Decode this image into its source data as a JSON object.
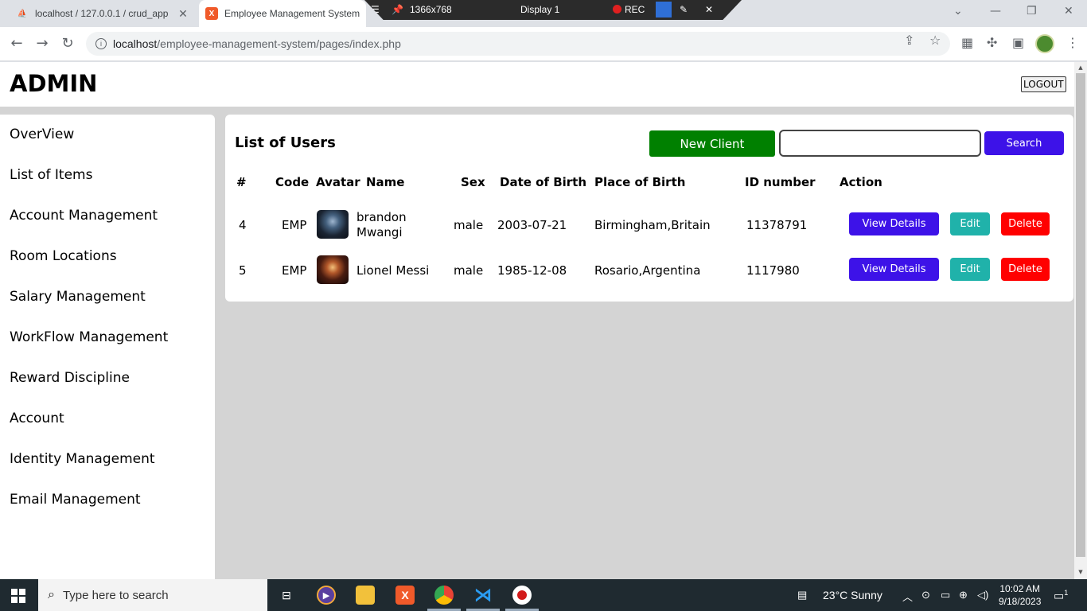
{
  "browser": {
    "tabs": [
      {
        "label": "localhost / 127.0.0.1 / crud_app /",
        "favicon": "phpmyadmin-icon"
      },
      {
        "label": "Employee Management System",
        "favicon": "xampp-icon"
      }
    ],
    "recorder": {
      "resolution": "1366x768",
      "display": "Display 1",
      "rec_label": "REC"
    },
    "url_host": "localhost",
    "url_path": "/employee-management-system/pages/index.php"
  },
  "app": {
    "brand": "ADMIN",
    "logout_label": "LOGOUT",
    "sidebar": [
      "OverView",
      "List of Items",
      "Account Management",
      "Room Locations",
      "Salary Management",
      "WorkFlow Management",
      "Reward Discipline",
      "Account",
      "Identity Management",
      "Email Management"
    ],
    "panel": {
      "title": "List of Users",
      "new_client_label": "New Client",
      "search_placeholder": "",
      "search_label": "Search",
      "columns": [
        "#",
        "Code",
        "Avatar",
        "Name",
        "Sex",
        "Date of Birth",
        "Place of Birth",
        "ID number",
        "Action"
      ],
      "rows": [
        {
          "num": "4",
          "code": "EMP",
          "name": "brandon Mwangi",
          "sex": "male",
          "dob": "2003-07-21",
          "pob": "Birmingham,Britain",
          "id_number": "11378791"
        },
        {
          "num": "5",
          "code": "EMP",
          "name": "Lionel Messi",
          "sex": "male",
          "dob": "1985-12-08",
          "pob": "Rosario,Argentina",
          "id_number": "1117980"
        }
      ],
      "actions": {
        "view": "View Details",
        "edit": "Edit",
        "delete": "Delete"
      }
    }
  },
  "taskbar": {
    "search_placeholder": "Type here to search",
    "weather": "23°C  Sunny",
    "time": "10:02 AM",
    "date": "9/18/2023",
    "notifications": "1"
  },
  "colors": {
    "new_client": "#008000",
    "primary": "#3d12e8",
    "edit": "#20b2aa",
    "delete": "#ff0000"
  }
}
